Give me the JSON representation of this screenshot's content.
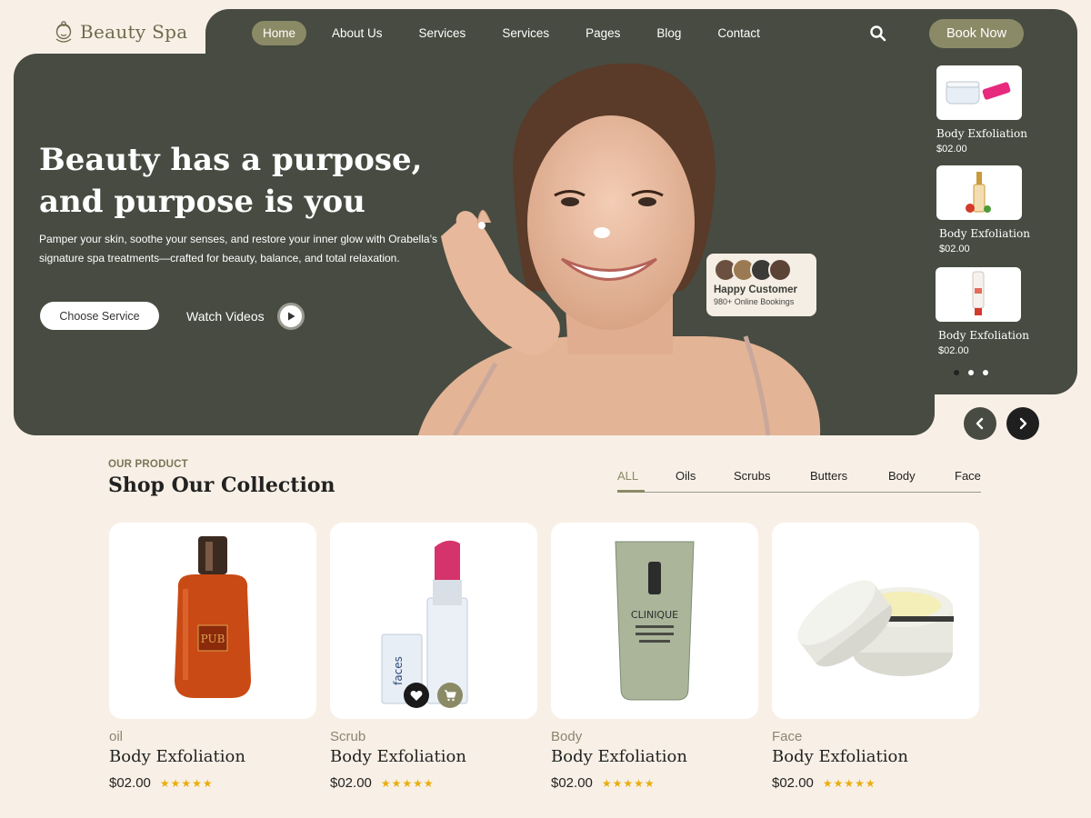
{
  "brand": {
    "name": "Beauty Spa"
  },
  "nav": {
    "items": [
      "Home",
      "About Us",
      "Services",
      "Services",
      "Pages",
      "Blog",
      "Contact"
    ],
    "active": "Home",
    "book_label": "Book Now"
  },
  "hero": {
    "title": "Beauty has a purpose,  and purpose is you",
    "description": "Pamper your skin, soothe your senses, and restore your inner glow with Orabella’s signature spa treatments—crafted for beauty, balance, and total relaxation.",
    "cta_primary": "Choose Service",
    "cta_secondary": "Watch Videos"
  },
  "happy_customer": {
    "title": "Happy Customer",
    "subtitle": "980+ Online Bookings"
  },
  "side_products": [
    {
      "name": "Body Exfoliation",
      "price": "$02.00"
    },
    {
      "name": "Body Exfoliation",
      "price": "$02.00"
    },
    {
      "name": "Body Exfoliation",
      "price": "$02.00"
    }
  ],
  "collection": {
    "eyebrow": "OUR PRODUCT",
    "title": "Shop Our Collection",
    "tabs": [
      "ALL",
      "Oils",
      "Scrubs",
      "Butters",
      "Body",
      "Face"
    ],
    "active_tab": "ALL",
    "products": [
      {
        "category": "oil",
        "name": "Body Exfoliation",
        "price": "$02.00",
        "rating": 5,
        "stars": "★★★★★"
      },
      {
        "category": "Scrub",
        "name": "Body Exfoliation",
        "price": "$02.00",
        "rating": 5,
        "stars": "★★★★★"
      },
      {
        "category": "Body",
        "name": "Body Exfoliation",
        "price": "$02.00",
        "rating": 5,
        "stars": "★★★★★"
      },
      {
        "category": "Face",
        "name": "Body Exfoliation",
        "price": "$02.00",
        "rating": 5,
        "stars": "★★★★★"
      }
    ]
  },
  "product_labels": {
    "perfume": "PUB",
    "cleanser": "CLINIQUE",
    "lipstick_tube": "faces"
  },
  "colors": {
    "olive_dark": "#474b41",
    "olive_accent": "#8b8a67",
    "cream_bg": "#f8f0e6",
    "star": "#e9ad0b"
  },
  "icons": [
    "logo-face-icon",
    "search-icon",
    "play-icon",
    "heart-icon",
    "cart-icon",
    "chevron-left-icon",
    "chevron-right-icon"
  ]
}
